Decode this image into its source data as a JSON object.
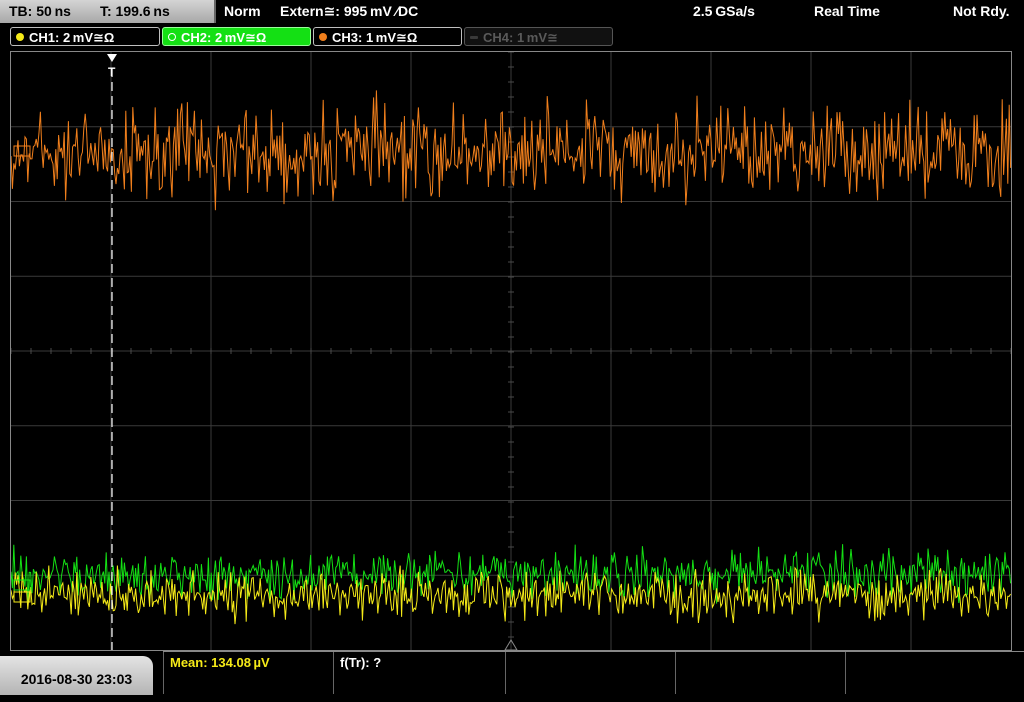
{
  "topbar": {
    "timebase": "TB: 50 ns",
    "trigger_time": "T: 199.6 ns",
    "trigger_mode": "Norm",
    "trigger_source": "Extern≅: 995 mV ∕DC",
    "sample_rate": "2.5 GSa/s",
    "acq_mode": "Real Time",
    "status": "Not Rdy."
  },
  "channels": [
    {
      "label": "CH1: 2 mV≅Ω",
      "color": "#f5ea18",
      "state": "on"
    },
    {
      "label": "CH2: 2 mV≅Ω",
      "color": "#14e014",
      "state": "selected"
    },
    {
      "label": "CH3: 1 mV≅Ω",
      "color": "#f07f1c",
      "state": "on"
    },
    {
      "label": "CH4: 1 mV≅",
      "color": "#5a5a5a",
      "state": "off"
    }
  ],
  "footer": {
    "datetime": "2016-08-30 23:03",
    "mean_label": "Mean: 134.08 µV",
    "freq_label": "f(Tr): ?"
  },
  "colors": {
    "ch1": "#f5ea18",
    "ch2": "#14e014",
    "ch3": "#f07f1c",
    "grid": "#3a3a3a",
    "mean_text": "#f5ea18"
  },
  "traces": {
    "ch3_noise_amplitude": 1.0,
    "ch2_noise_amplitude": 0.45,
    "ch1_noise_amplitude": 0.45
  }
}
